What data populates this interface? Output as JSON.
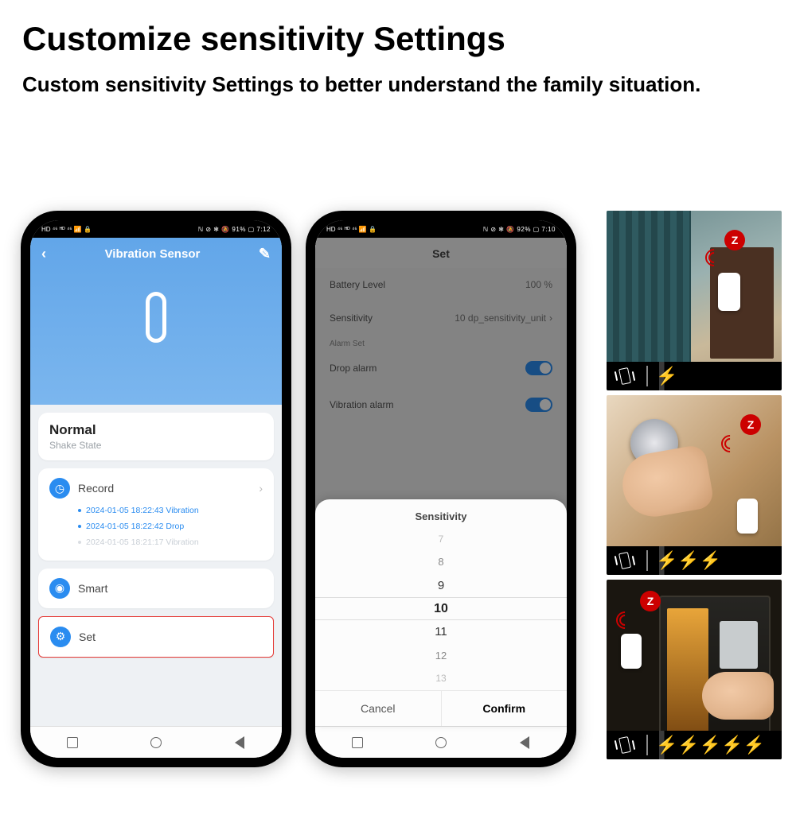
{
  "headline": "Customize sensitivity Settings",
  "subhead": "Custom sensitivity Settings to better understand the family situation.",
  "phone1": {
    "status_left": "HD ⁴⁶ ᴴᴰ ⁴⁶ 📶 🔒",
    "status_right": "ℕ ⊘ ✻ 🔕 91% ▢ 7:12",
    "nav_title": "Vibration Sensor",
    "state": {
      "title": "Normal",
      "subtitle": "Shake State"
    },
    "record_label": "Record",
    "records": [
      "2024-01-05 18:22:43 Vibration",
      "2024-01-05 18:22:42 Drop",
      "2024-01-05 18:21:17 Vibration"
    ],
    "smart_label": "Smart",
    "set_label": "Set"
  },
  "phone2": {
    "status_left": "HD ⁴⁶ ᴴᴰ ⁴⁶ 📶 🔒",
    "status_right": "ℕ ⊘ ✻ 🔕 92% ▢ 7:10",
    "page_title": "Set",
    "rows": {
      "battery_label": "Battery Level",
      "battery_value": "100 %",
      "sensitivity_label": "Sensitivity",
      "sensitivity_value": "10 dp_sensitivity_unit",
      "alarm_section": "Alarm Set",
      "drop_label": "Drop alarm",
      "vibration_label": "Vibration alarm"
    },
    "sheet": {
      "title": "Sensitivity",
      "options": [
        "7",
        "8",
        "9",
        "10",
        "11",
        "12",
        "13"
      ],
      "cancel": "Cancel",
      "confirm": "Confirm"
    }
  },
  "zig": "Z",
  "bolt": "⚡"
}
